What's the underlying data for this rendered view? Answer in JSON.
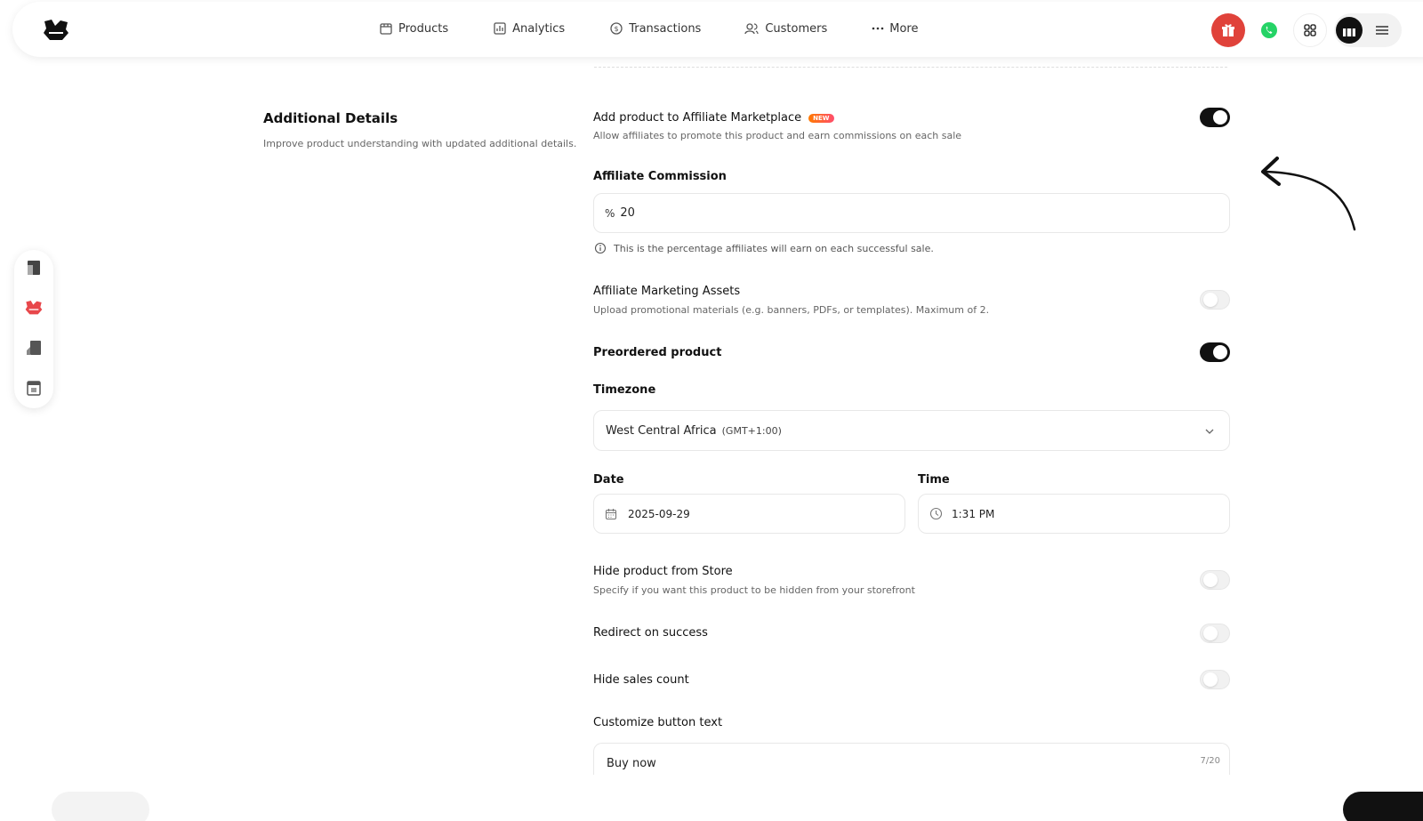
{
  "nav": {
    "products": "Products",
    "analytics": "Analytics",
    "transactions": "Transactions",
    "customers": "Customers",
    "more": "More"
  },
  "section": {
    "title": "Additional Details",
    "subtitle": "Improve product understanding with updated additional details."
  },
  "affiliate": {
    "title": "Add product to Affiliate Marketplace",
    "badge": "NEW",
    "desc": "Allow affiliates to promote this product and earn commissions on each sale",
    "enabled": true
  },
  "commission": {
    "label": "Affiliate Commission",
    "prefix": "%",
    "value": "20",
    "hint": "This is the percentage affiliates will earn on each successful sale."
  },
  "assets": {
    "title": "Affiliate Marketing Assets",
    "desc": "Upload promotional materials (e.g. banners, PDFs, or templates). Maximum of 2.",
    "enabled": false
  },
  "preorder": {
    "title": "Preordered product",
    "enabled": true
  },
  "timezone": {
    "label": "Timezone",
    "value": "West Central Africa",
    "offset": "(GMT+1:00)"
  },
  "date": {
    "label": "Date",
    "value": "2025-09-29"
  },
  "time": {
    "label": "Time",
    "value": "1:31 PM"
  },
  "hide_store": {
    "title": "Hide product from Store",
    "desc": "Specify if you want this product to be hidden from your storefront",
    "enabled": false
  },
  "redirect": {
    "title": "Redirect on success",
    "enabled": false
  },
  "hide_sales": {
    "title": "Hide sales count",
    "enabled": false
  },
  "button_text": {
    "label": "Customize button text",
    "value": "Buy now",
    "counter": "7/20"
  },
  "colors": {
    "accent_dark": "#111111",
    "gift": "#e0423a",
    "whatsapp": "#25d366",
    "badge_from": "#ff7a00",
    "badge_to": "#ff4d6d"
  }
}
